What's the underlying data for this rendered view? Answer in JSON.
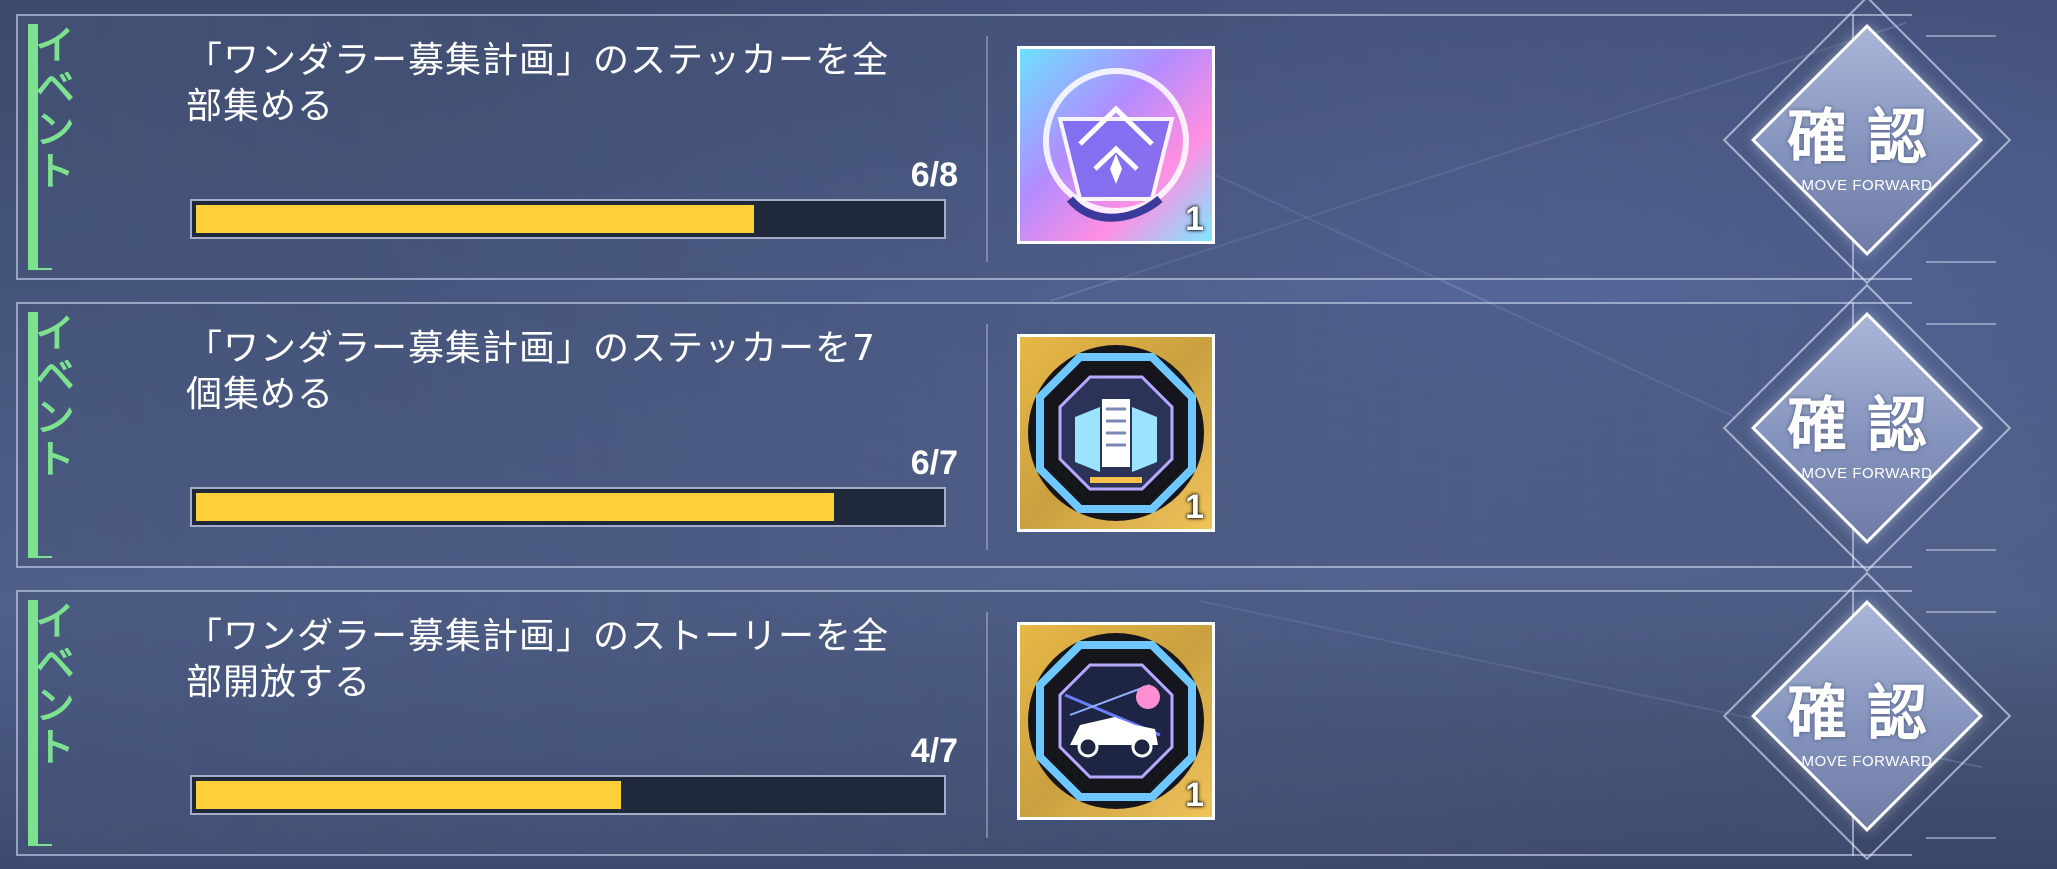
{
  "missions": [
    {
      "tag": "イベント",
      "text": "「ワンダラー募集計画」のステッカーを全\n部集める",
      "progress_text": "6/8",
      "progress_fraction": 0.75,
      "reward_icon": "hologram-sticker-icon",
      "reward_count": "1",
      "confirm_label": "確認",
      "confirm_sub": "MOVE FORWARD"
    },
    {
      "tag": "イベント",
      "text": "「ワンダラー募集計画」のステッカーを7\n個集める",
      "progress_text": "6/7",
      "progress_fraction": 0.857,
      "reward_icon": "building-badge-icon",
      "reward_count": "1",
      "confirm_label": "確認",
      "confirm_sub": "MOVE FORWARD"
    },
    {
      "tag": "イベント",
      "text": "「ワンダラー募集計画」のストーリーを全\n部開放する",
      "progress_text": "4/7",
      "progress_fraction": 0.571,
      "reward_icon": "car-badge-icon",
      "reward_count": "1",
      "confirm_label": "確認",
      "confirm_sub": "MOVE FORWARD"
    }
  ],
  "colors": {
    "tag": "#7de28f",
    "progress_fill": "#ffcf3a",
    "progress_track": "#20283c"
  }
}
